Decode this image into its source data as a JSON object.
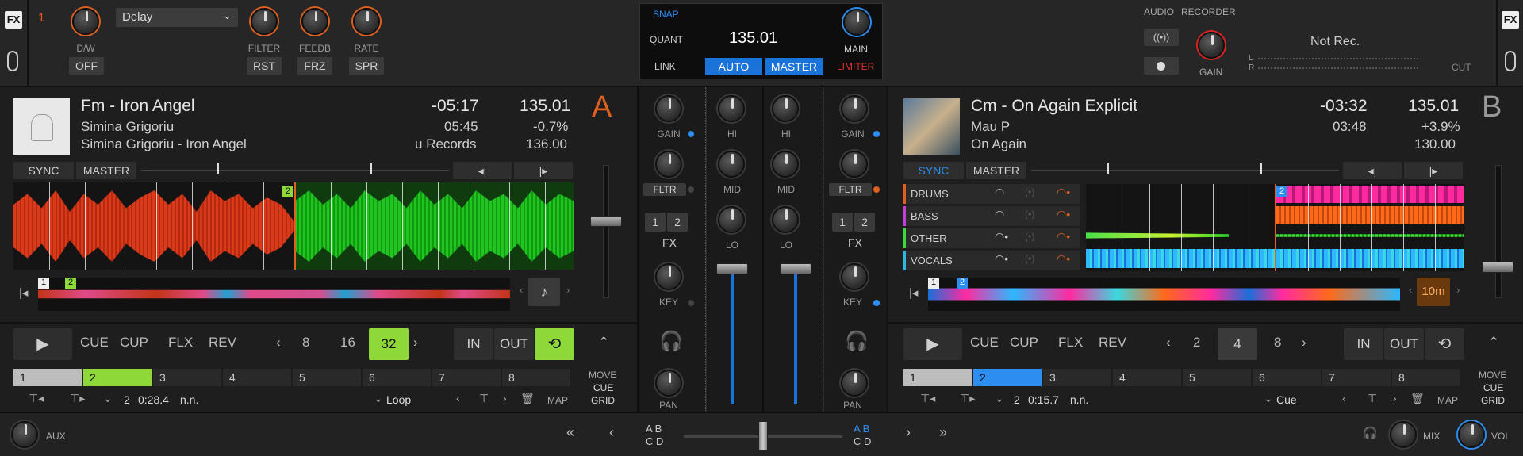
{
  "fx": {
    "logo": "FX",
    "unit_num": "1",
    "effect": "Delay",
    "dw_label": "D/W",
    "off_btn": "OFF",
    "filter_label": "FILTER",
    "feedb_label": "FEEDB",
    "rate_label": "RATE",
    "rst_btn": "RST",
    "frz_btn": "FRZ",
    "spr_btn": "SPR"
  },
  "master": {
    "snap": "SNAP",
    "quant": "QUANT",
    "link": "LINK",
    "bpm": "135.01",
    "auto": "AUTO",
    "master_btn": "MASTER",
    "main": "MAIN",
    "limiter": "LIMITER"
  },
  "recorder": {
    "audio": "AUDIO",
    "recorder": "RECORDER",
    "gain": "GAIN",
    "status": "Not Rec.",
    "l": "L",
    "r": "R",
    "cut": "CUT"
  },
  "deckA": {
    "letter": "A",
    "title": "Fm - Iron Angel",
    "artist": "Simina Grigoriu",
    "album": "Simina Grigoriu - Iron Angel",
    "remaining": "-05:17",
    "elapsed": "05:45",
    "label": "u Records",
    "bpm": "135.01",
    "pitch": "-0.7%",
    "orig_bpm": "136.00",
    "sync": "SYNC",
    "master": "MASTER",
    "cue_marker": "2",
    "overview_m1": "1",
    "overview_m2": "2",
    "cue": "CUE",
    "cup": "CUP",
    "flx": "FLX",
    "rev": "REV",
    "loops": [
      "8",
      "16",
      "32"
    ],
    "in": "IN",
    "out": "OUT",
    "hotcues": [
      "1",
      "2",
      "3",
      "4",
      "5",
      "6",
      "7",
      "8"
    ],
    "move": "MOVE",
    "move_cue": "CUE",
    "move_grid": "GRID",
    "cue_num": "2",
    "cue_time": "0:28.4",
    "cue_name": "n.n.",
    "cue_type": "Loop",
    "map": "MAP"
  },
  "deckB": {
    "letter": "B",
    "title": "Cm - On Again Explicit",
    "artist": "Mau P",
    "album": "On Again",
    "remaining": "-03:32",
    "elapsed": "03:48",
    "bpm": "135.01",
    "pitch": "+3.9%",
    "orig_bpm": "130.00",
    "sync": "SYNC",
    "master": "MASTER",
    "stems": [
      "DRUMS",
      "BASS",
      "OTHER",
      "VOCALS"
    ],
    "overview_m1": "1",
    "overview_m2": "2",
    "waveform_marker": "2",
    "time_badge": "10m",
    "cue": "CUE",
    "cup": "CUP",
    "flx": "FLX",
    "rev": "REV",
    "loops": [
      "2",
      "4",
      "8"
    ],
    "in": "IN",
    "out": "OUT",
    "hotcues": [
      "1",
      "2",
      "3",
      "4",
      "5",
      "6",
      "7",
      "8"
    ],
    "move": "MOVE",
    "move_cue": "CUE",
    "move_grid": "GRID",
    "cue_num": "2",
    "cue_time": "0:15.7",
    "cue_name": "n.n.",
    "cue_type": "Cue",
    "map": "MAP"
  },
  "mixer": {
    "gain": "GAIN",
    "hi": "HI",
    "mid": "MID",
    "lo": "LO",
    "fltr": "FLTR",
    "fx": "FX",
    "fx1": "1",
    "fx2": "2",
    "key": "KEY",
    "pan": "PAN"
  },
  "footer": {
    "aux": "AUX",
    "mix": "MIX",
    "vol": "VOL",
    "ab_l": "A B",
    "cd_l": "C D",
    "ab_r": "A B",
    "cd_r": "C D"
  }
}
